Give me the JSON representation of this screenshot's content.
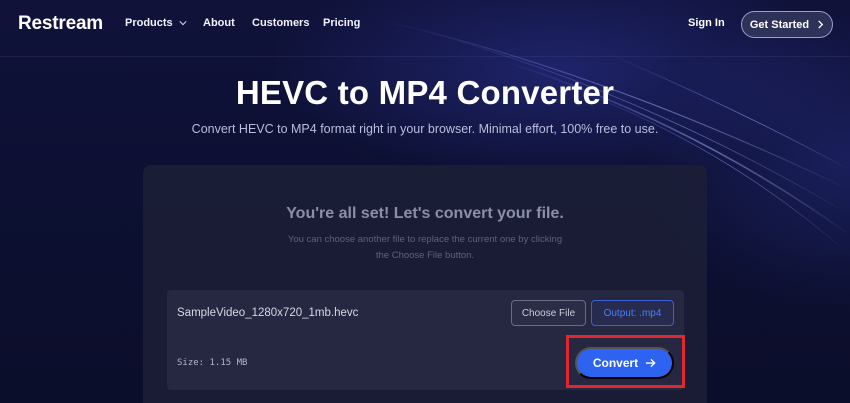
{
  "nav": {
    "logo": "Restream",
    "items": [
      {
        "label": "Products",
        "has_dropdown": true
      },
      {
        "label": "About"
      },
      {
        "label": "Customers"
      },
      {
        "label": "Pricing"
      }
    ],
    "signin": "Sign In",
    "get_started": "Get Started"
  },
  "hero": {
    "title": "HEVC to MP4 Converter",
    "subtitle": "Convert HEVC to MP4 format right in your browser. Minimal effort, 100% free to use."
  },
  "card": {
    "title": "You're all set! Let's convert your file.",
    "description": "You can choose another file to replace the current one by clicking the Choose File button.",
    "file": {
      "name": "SampleVideo_1280x720_1mb.hevc",
      "size": "Size: 1.15 MB"
    },
    "choose_file": "Choose File",
    "output": "Output: .mp4",
    "convert": "Convert"
  },
  "colors": {
    "accent": "#2d63f0",
    "highlight_box": "#e0262f",
    "background": "#0c0f2e"
  },
  "icons": {
    "products_chevron": "chevron-down-icon",
    "get_started_arrow": "chevron-right-icon",
    "convert_arrow": "arrow-right-icon"
  }
}
